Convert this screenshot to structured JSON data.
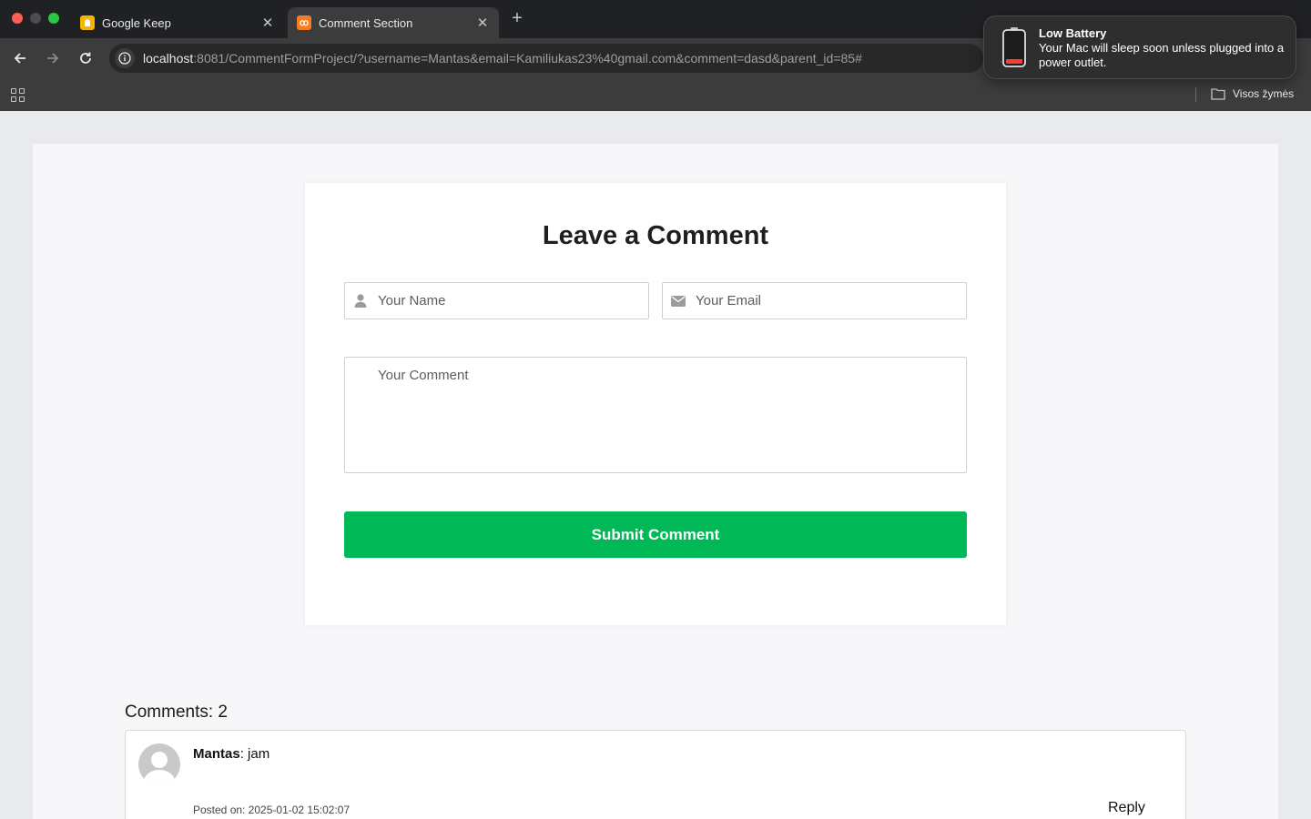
{
  "browser": {
    "tabs": [
      {
        "title": "Google Keep",
        "active": false,
        "favicon": "google-keep-icon"
      },
      {
        "title": "Comment Section",
        "active": true,
        "favicon": "xampp-icon"
      }
    ],
    "url_host": "localhost",
    "url_rest": ":8081/CommentFormProject/?username=Mantas&email=Kamiliukas23%40gmail.com&comment=dasd&parent_id=85#",
    "bookmarks_all": "Visos žymės"
  },
  "notification": {
    "title": "Low Battery",
    "body": "Your Mac will sleep soon unless plugged into a power outlet."
  },
  "form": {
    "title": "Leave a Comment",
    "name_placeholder": "Your Name",
    "email_placeholder": "Your Email",
    "comment_placeholder": "Your Comment",
    "submit_label": "Submit Comment"
  },
  "comments": {
    "count_label": "Comments: 2",
    "items": [
      {
        "author": "Mantas",
        "text": ": jam",
        "posted": "Posted on: 2025-01-02 15:02:07",
        "reply_label": "Reply"
      }
    ]
  },
  "colors": {
    "accent": "#00b956",
    "chrome_bg": "#202124",
    "toolbar_bg": "#3c3c3c"
  }
}
